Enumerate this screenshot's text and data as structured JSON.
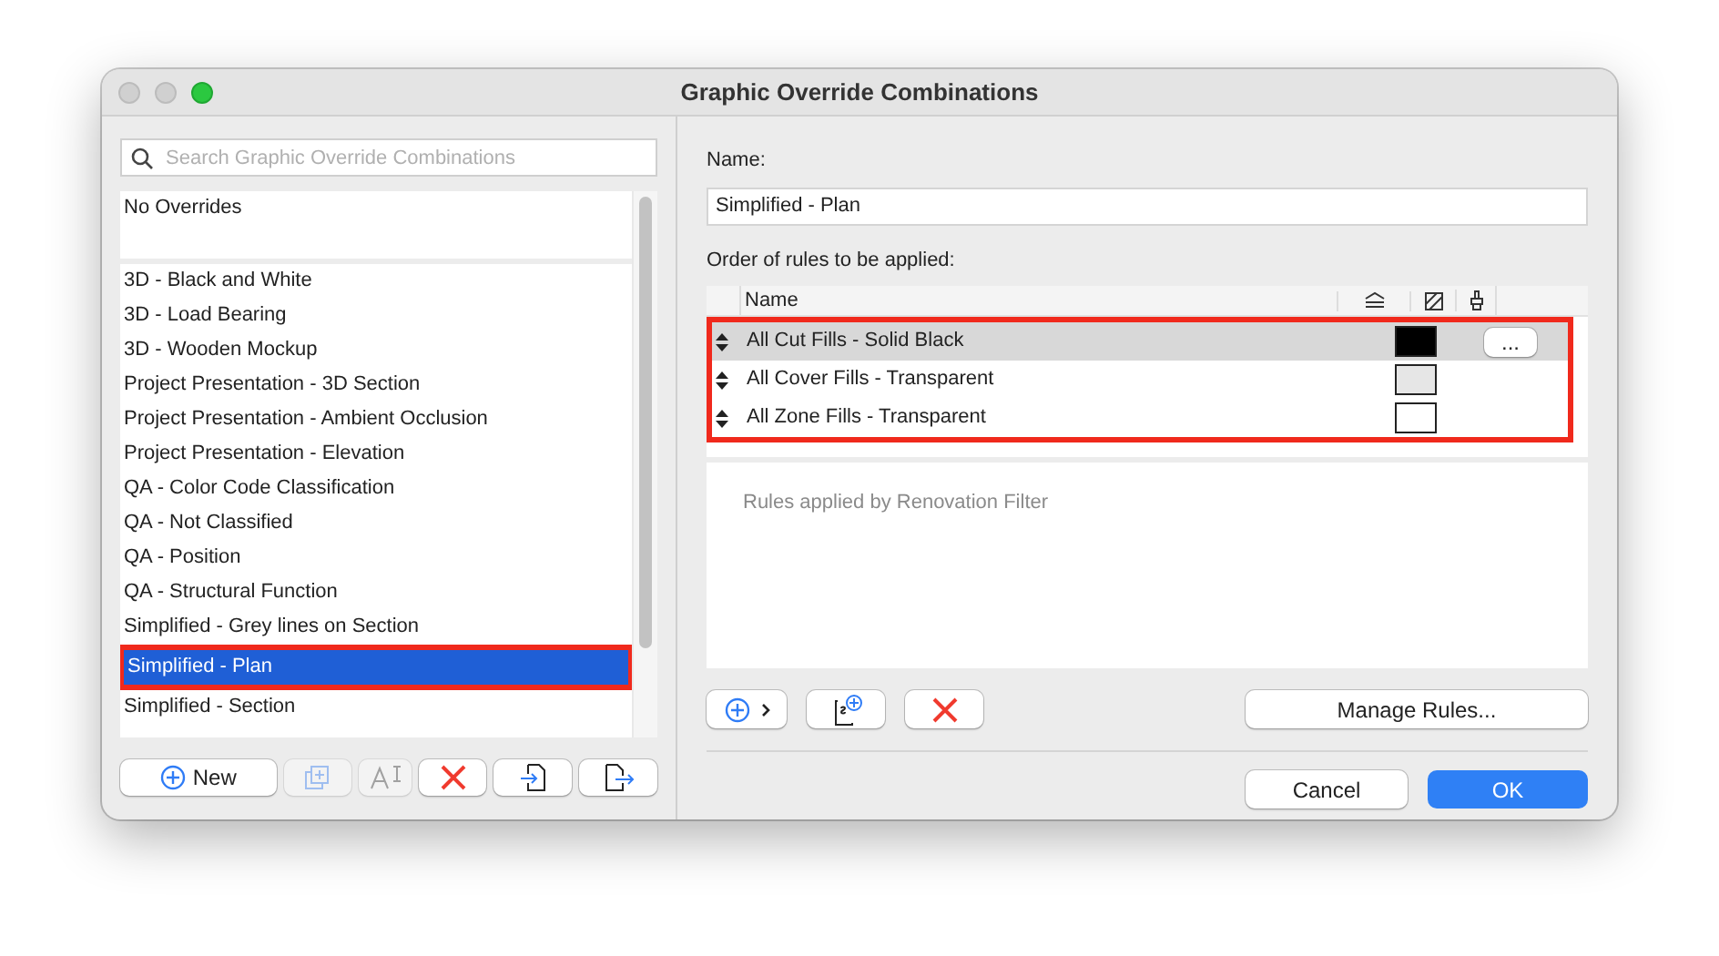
{
  "window": {
    "title": "Graphic Override Combinations"
  },
  "search": {
    "placeholder": "Search Graphic Override Combinations"
  },
  "combinations": [
    {
      "label": "No Overrides",
      "selected": false,
      "highlighted": false,
      "separator_after": true
    },
    {
      "label": "3D - Black and White",
      "selected": false,
      "highlighted": false
    },
    {
      "label": "3D - Load Bearing",
      "selected": false,
      "highlighted": false
    },
    {
      "label": "3D - Wooden Mockup",
      "selected": false,
      "highlighted": false
    },
    {
      "label": "Project Presentation - 3D Section",
      "selected": false,
      "highlighted": false
    },
    {
      "label": "Project Presentation - Ambient Occlusion",
      "selected": false,
      "highlighted": false
    },
    {
      "label": "Project Presentation - Elevation",
      "selected": false,
      "highlighted": false
    },
    {
      "label": "QA - Color Code Classification",
      "selected": false,
      "highlighted": false
    },
    {
      "label": "QA - Not Classified",
      "selected": false,
      "highlighted": false
    },
    {
      "label": "QA - Position",
      "selected": false,
      "highlighted": false
    },
    {
      "label": "QA - Structural Function",
      "selected": false,
      "highlighted": false
    },
    {
      "label": "Simplified - Grey lines on Section",
      "selected": false,
      "highlighted": false
    },
    {
      "label": "Simplified - Plan",
      "selected": true,
      "highlighted": true
    },
    {
      "label": "Simplified - Section",
      "selected": false,
      "highlighted": false
    }
  ],
  "left_buttons": [
    {
      "kind": "new",
      "label": "New",
      "disabled": false
    },
    {
      "kind": "duplicate",
      "disabled": true
    },
    {
      "kind": "rename",
      "disabled": true
    },
    {
      "kind": "delete",
      "disabled": false
    },
    {
      "kind": "import",
      "disabled": false
    },
    {
      "kind": "export",
      "disabled": false
    }
  ],
  "name_field": {
    "label": "Name:",
    "value": "Simplified - Plan"
  },
  "rules": {
    "label": "Order of rules to be applied:",
    "column_name": "Name",
    "highlighted": true,
    "rows": [
      {
        "name": "All Cut Fills - Solid Black",
        "selected": true,
        "color": "#000000",
        "more": "..."
      },
      {
        "name": "All Cover Fills - Transparent",
        "selected": false,
        "color": "#e6e6e6"
      },
      {
        "name": "All Zone Fills - Transparent",
        "selected": false,
        "color": "#ffffff"
      }
    ],
    "renovation_label": "Rules applied by Renovation Filter"
  },
  "rule_buttons": {
    "manage": "Manage Rules..."
  },
  "footer": {
    "cancel": "Cancel",
    "ok": "OK"
  }
}
